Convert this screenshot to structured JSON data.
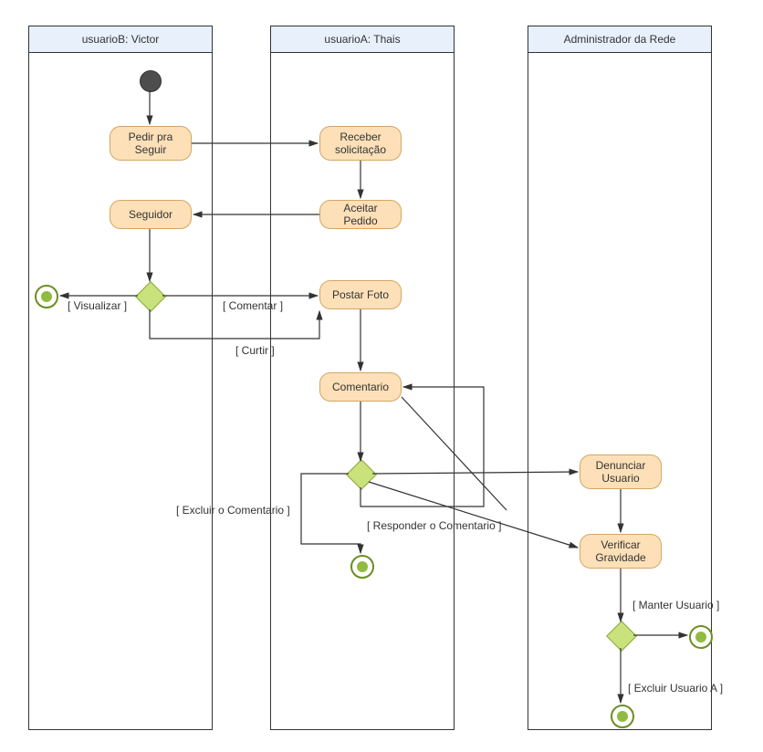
{
  "lanes": {
    "lane1": "usuarioB: Victor",
    "lane2": "usuarioA: Thais",
    "lane3": "Administrador da Rede"
  },
  "nodes": {
    "pedir": "Pedir pra Seguir",
    "receber": "Receber solicitação",
    "aceitar": "Aceitar Pedido",
    "seguidor": "Seguidor",
    "postar": "Postar Foto",
    "comentario": "Comentario",
    "denunciar": "Denunciar Usuario",
    "verificar": "Verificar Gravidade"
  },
  "guards": {
    "visualizar": "[ Visualizar ]",
    "comentar": "[ Comentar ]",
    "curtir": "[ Curtir ]",
    "excluir_com": "[ Excluir o Comentario ]",
    "responder": "[ Responder o Comentario ]",
    "manter": "[ Manter Usuario ]",
    "excluir_user": "[ Excluir Usuario A ]"
  },
  "chart_data": {
    "type": "activity-diagram",
    "swimlanes": [
      {
        "id": "lane1",
        "name": "usuarioB: Victor"
      },
      {
        "id": "lane2",
        "name": "usuarioA: Thais"
      },
      {
        "id": "lane3",
        "name": "Administrador da Rede"
      }
    ],
    "nodes": [
      {
        "id": "start",
        "type": "initial",
        "lane": "lane1"
      },
      {
        "id": "pedir",
        "type": "activity",
        "lane": "lane1",
        "label": "Pedir pra Seguir"
      },
      {
        "id": "receber",
        "type": "activity",
        "lane": "lane2",
        "label": "Receber solicitação"
      },
      {
        "id": "aceitar",
        "type": "activity",
        "lane": "lane2",
        "label": "Aceitar Pedido"
      },
      {
        "id": "seguidor",
        "type": "activity",
        "lane": "lane1",
        "label": "Seguidor"
      },
      {
        "id": "d1",
        "type": "decision",
        "lane": "lane1"
      },
      {
        "id": "final1",
        "type": "final",
        "lane": "lane1"
      },
      {
        "id": "postar",
        "type": "activity",
        "lane": "lane2",
        "label": "Postar Foto"
      },
      {
        "id": "comentario",
        "type": "activity",
        "lane": "lane2",
        "label": "Comentario"
      },
      {
        "id": "d2",
        "type": "decision",
        "lane": "lane2"
      },
      {
        "id": "final2",
        "type": "final",
        "lane": "lane2"
      },
      {
        "id": "denunciar",
        "type": "activity",
        "lane": "lane3",
        "label": "Denunciar Usuario"
      },
      {
        "id": "verificar",
        "type": "activity",
        "lane": "lane3",
        "label": "Verificar Gravidade"
      },
      {
        "id": "d3",
        "type": "decision",
        "lane": "lane3"
      },
      {
        "id": "final3",
        "type": "final",
        "lane": "lane3"
      },
      {
        "id": "final4",
        "type": "final",
        "lane": "lane3"
      }
    ],
    "edges": [
      {
        "from": "start",
        "to": "pedir"
      },
      {
        "from": "pedir",
        "to": "receber"
      },
      {
        "from": "receber",
        "to": "aceitar"
      },
      {
        "from": "aceitar",
        "to": "seguidor"
      },
      {
        "from": "seguidor",
        "to": "d1"
      },
      {
        "from": "d1",
        "to": "final1",
        "guard": "[ Visualizar ]"
      },
      {
        "from": "d1",
        "to": "postar",
        "guard": "[ Comentar ]"
      },
      {
        "from": "d1",
        "to": "postar",
        "guard": "[ Curtir ]"
      },
      {
        "from": "postar",
        "to": "comentario"
      },
      {
        "from": "comentario",
        "to": "d2"
      },
      {
        "from": "d2",
        "to": "final2",
        "guard": "[ Excluir o Comentario ]"
      },
      {
        "from": "d2",
        "to": "comentario",
        "guard": "[ Responder o Comentario ]"
      },
      {
        "from": "d2",
        "to": "denunciar"
      },
      {
        "from": "denunciar",
        "to": "verificar"
      },
      {
        "from": "d2",
        "to": "verificar"
      },
      {
        "from": "verificar",
        "to": "d3"
      },
      {
        "from": "d3",
        "to": "final3",
        "guard": "[ Manter Usuario ]"
      },
      {
        "from": "d3",
        "to": "final4",
        "guard": "[ Excluir Usuario A ]"
      }
    ]
  }
}
